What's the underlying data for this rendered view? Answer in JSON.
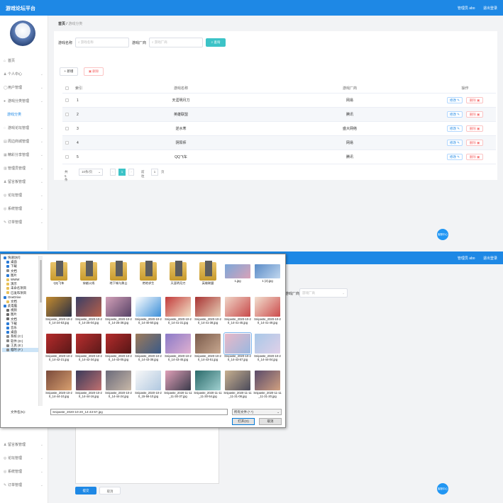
{
  "app": {
    "brand": "游戏论坛平台",
    "user_label": "管理员 abo",
    "logout_label": "退出登录"
  },
  "sidebar": {
    "items": [
      {
        "icon": "home-icon",
        "glyph": "⌂",
        "label": "首页",
        "has_children": false
      },
      {
        "icon": "user-icon",
        "glyph": "♟",
        "label": "个人中心",
        "has_children": true
      },
      {
        "icon": "users-icon",
        "glyph": "◯",
        "label": "用户管理",
        "has_children": true
      },
      {
        "icon": "category-icon",
        "glyph": "●",
        "label": "游戏分类管理",
        "has_children": true
      },
      {
        "icon": "list-item-icon",
        "glyph": "",
        "label": "游戏分类",
        "has_children": false,
        "sub": true
      },
      {
        "icon": "chat-icon",
        "glyph": "◌",
        "label": "游戏论坛管理",
        "has_children": true
      },
      {
        "icon": "shop-icon",
        "glyph": "▤",
        "label": "周边商城管理",
        "has_children": true
      },
      {
        "icon": "grid-icon",
        "glyph": "▦",
        "label": "精彩分享管理",
        "has_children": true
      },
      {
        "icon": "cog-icon",
        "glyph": "▥",
        "label": "管理员管理",
        "has_children": true
      },
      {
        "icon": "person-icon",
        "glyph": "♟",
        "label": "留言板管理",
        "has_children": true
      },
      {
        "icon": "info-icon",
        "glyph": "◎",
        "label": "论坛管理",
        "has_children": true
      },
      {
        "icon": "system-icon",
        "glyph": "◎",
        "label": "系统管理",
        "has_children": true
      },
      {
        "icon": "order-icon",
        "glyph": "✎",
        "label": "订单管理",
        "has_children": true
      }
    ]
  },
  "breadcrumb": {
    "home": "首页",
    "sep": "/",
    "current": "游戏分类"
  },
  "search": {
    "name_label": "游戏名称",
    "name_placeholder": "游戏名称",
    "vendor_label": "游戏厂商",
    "vendor_placeholder": "游戏厂商",
    "query_label": "查询"
  },
  "actions": {
    "add_label": "+ 新增",
    "delete_label": "删除"
  },
  "table": {
    "headers": [
      "索引",
      "游戏名称",
      "游戏厂商",
      "操作"
    ],
    "rows": [
      {
        "index": "1",
        "name": "天涯明月刀",
        "vendor": "网易"
      },
      {
        "index": "2",
        "name": "英雄联盟",
        "vendor": "腾讯"
      },
      {
        "index": "3",
        "name": "逆水寒",
        "vendor": "盛大网络"
      },
      {
        "index": "4",
        "name": "阴阳师",
        "vendor": "网易"
      },
      {
        "index": "5",
        "name": "QQ飞车",
        "vendor": "腾讯"
      }
    ],
    "edit_label": "修改",
    "delete_label": "删除"
  },
  "pager": {
    "total": "共 5 条",
    "size": "10条/页",
    "page": "1",
    "goto": "前往",
    "goto_val": "1",
    "unit": "页"
  },
  "float_label": "客服中心",
  "dialog": {
    "tree": [
      {
        "label": "快速访问",
        "color": "#2b7bd6"
      },
      {
        "label": "桌面",
        "color": "#2b7bd6"
      },
      {
        "label": "下载",
        "color": "#2b7bd6"
      },
      {
        "label": "文档",
        "color": "#8a8a8a"
      },
      {
        "label": "图片",
        "color": "#2b7bd6"
      },
      {
        "label": "WWW",
        "color": "#e8c15a"
      },
      {
        "label": "演示",
        "color": "#e8c15a"
      },
      {
        "label": "未命名项目",
        "color": "#e8c15a"
      },
      {
        "label": "已发布项目",
        "color": "#e8c15a"
      },
      {
        "label": "OneDrive",
        "color": "#2b7bd6"
      },
      {
        "label": "文档",
        "color": "#e8c15a"
      },
      {
        "label": "此电脑",
        "color": "#2b7bd6"
      },
      {
        "label": "视频",
        "color": "#6a6a6a"
      },
      {
        "label": "图片",
        "color": "#6a6a6a"
      },
      {
        "label": "文档",
        "color": "#6a6a6a"
      },
      {
        "label": "下载",
        "color": "#2b7bd6"
      },
      {
        "label": "音乐",
        "color": "#2b7bd6"
      },
      {
        "label": "桌面",
        "color": "#2b7bd6"
      },
      {
        "label": "系统 (C:)",
        "color": "#888888"
      },
      {
        "label": "软件 (D:)",
        "color": "#888888"
      },
      {
        "label": "工具 (E:)",
        "color": "#888888"
      },
      {
        "label": "临时 (F:)",
        "color": "#888888"
      }
    ],
    "files": [
      {
        "name": "QQ飞车",
        "kind": "folder"
      },
      {
        "name": "穿越火线",
        "kind": "folder"
      },
      {
        "name": "地下城与勇士",
        "kind": "folder"
      },
      {
        "name": "绝地求生",
        "kind": "folder"
      },
      {
        "name": "天涯明月刀",
        "kind": "folder"
      },
      {
        "name": "英雄联盟",
        "kind": "folder"
      },
      {
        "name": "1.jpg",
        "kind": "image",
        "c1": "#7ba7d9",
        "c2": "#d9a2b8"
      },
      {
        "name": "1 (2).jpg",
        "kind": "image",
        "c1": "#5b8cc7",
        "c2": "#c0d6ee"
      },
      {
        "name": "Snipaste_2020-10-20_14-24-53.jpg",
        "kind": "image",
        "c1": "#c48b2e",
        "c2": "#2a2f45"
      },
      {
        "name": "Snipaste_2020-10-20_14-25-04.jpg",
        "kind": "image",
        "c1": "#3b3f66",
        "c2": "#b8604a"
      },
      {
        "name": "Snipaste_2020-10-20_14-25-38.jpg",
        "kind": "image",
        "c1": "#d2a0b8",
        "c2": "#574266"
      },
      {
        "name": "Snipaste_2020-10-20_14-40-50.jpg",
        "kind": "image",
        "c1": "#ffffff",
        "c2": "#3c8fd8"
      },
      {
        "name": "Snipaste_2020-10-20_14-41-31.jpg",
        "kind": "image",
        "c1": "#c23a3a",
        "c2": "#f2e2c8"
      },
      {
        "name": "Snipaste_2020-10-20_14-41-38.jpg",
        "kind": "image",
        "c1": "#a83232",
        "c2": "#e8d0b8"
      },
      {
        "name": "Snipaste_2020-10-20_14-41-45.jpg",
        "kind": "image",
        "c1": "#f0d6c8",
        "c2": "#c84a4a"
      },
      {
        "name": "Snipaste_2020-10-20_14-41-49.jpg",
        "kind": "image",
        "c1": "#f2e0d0",
        "c2": "#cc4c4c"
      },
      {
        "name": "Snipaste_2020-10-20_14-42-21.jpg",
        "kind": "image",
        "c1": "#b52b2b",
        "c2": "#5a1818"
      },
      {
        "name": "Snipaste_2020-10-20_14-42-34.jpg",
        "kind": "image",
        "c1": "#b82e2e",
        "c2": "#5c1a1a"
      },
      {
        "name": "Snipaste_2020-10-20_14-43-05.jpg",
        "kind": "image",
        "c1": "#b42c2c",
        "c2": "#561616"
      },
      {
        "name": "Snipaste_2020-10-20_14-43-38.jpg",
        "kind": "image",
        "c1": "#9c7a5a",
        "c2": "#3a5a88"
      },
      {
        "name": "Snipaste_2020-10-20_14-43-45.jpg",
        "kind": "image",
        "c1": "#8a7ac8",
        "c2": "#e0b0d0"
      },
      {
        "name": "Snipaste_2020-10-20_14-43-51.jpg",
        "kind": "image",
        "c1": "#7a5a4a",
        "c2": "#c8a890"
      },
      {
        "name": "Snipaste_2020-10-20_14-43-57.jpg",
        "kind": "image",
        "c1": "#e8b8c8",
        "c2": "#9ab8e0",
        "selected": true
      },
      {
        "name": "Snipaste_2020-10-20_14-44-04.jpg",
        "kind": "image",
        "c1": "#a8c8e8",
        "c2": "#e0d0e8"
      },
      {
        "name": "Snipaste_2020-10-20_14-44-10.jpg",
        "kind": "image",
        "c1": "#7a4a3a",
        "c2": "#d8a070"
      },
      {
        "name": "Snipaste_2020-10-20_14-44-16.jpg",
        "kind": "image",
        "c1": "#3a3a5a",
        "c2": "#c07070"
      },
      {
        "name": "Snipaste_2020-10-20_14-44-24.jpg",
        "kind": "image",
        "c1": "#6a6a7a",
        "c2": "#c8b8a8"
      },
      {
        "name": "Snipaste_2020-10-20_15-56-10.jpg",
        "kind": "image",
        "c1": "#f8f8f8",
        "c2": "#b0c8e0"
      },
      {
        "name": "Snipaste_2020-11-11_11-30-37.jpg",
        "kind": "image",
        "c1": "#e0a0b8",
        "c2": "#3a3a4a"
      },
      {
        "name": "Snipaste_2020-11-11_11-30-54.jpg",
        "kind": "image",
        "c1": "#2a6a6a",
        "c2": "#a0d0d0"
      },
      {
        "name": "Snipaste_2020-11-11_11-31-08.jpg",
        "kind": "image",
        "c1": "#c8b090",
        "c2": "#4a4a5a"
      },
      {
        "name": "Snipaste_2020-11-11_11-31-20.jpg",
        "kind": "image",
        "c1": "#5a4a6a",
        "c2": "#d0a080"
      }
    ],
    "filename_label": "文件名(N):",
    "filename_value": "Snipaste_2020-10-20_14-43-57.jpg",
    "filetype_value": "所有文件 (*.*)",
    "open_label": "打开(O)",
    "cancel_label": "取消"
  },
  "form2": {
    "vendor_label": "游戏厂商",
    "vendor_placeholder": "游戏厂商",
    "submit_label": "提交",
    "cancel_label": "取消"
  },
  "colors": {
    "topbar": "#1e88e5",
    "accent": "#3cc3c7",
    "danger": "#f56c6c"
  }
}
